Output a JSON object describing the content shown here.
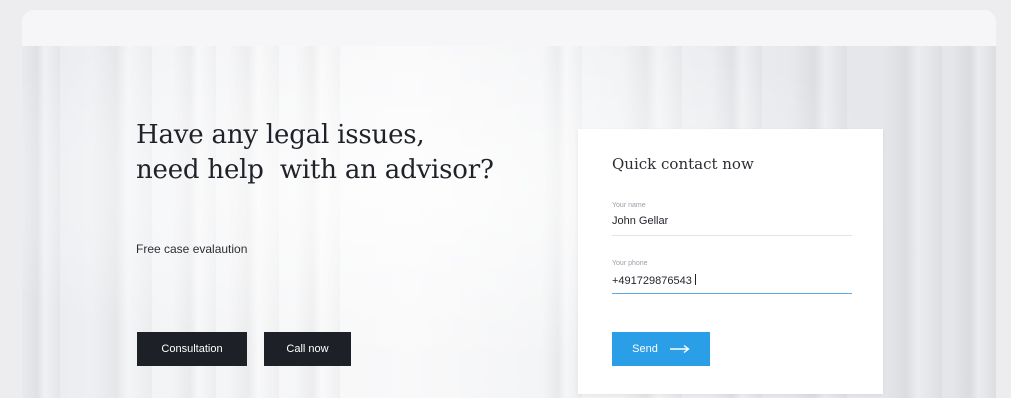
{
  "hero": {
    "headline_line1": "Have any legal issues,",
    "headline_line2": "need help  with an advisor?",
    "subtitle": "Free case evalaution",
    "consultation_label": "Consultation",
    "call_label": "Call now"
  },
  "contact_form": {
    "title": "Quick contact now",
    "name_label": "Your name",
    "name_value": "John Gellar",
    "phone_label": "Your phone",
    "phone_value": "+491729876543",
    "send_label": "Send",
    "send_icon": "arrow-right-icon"
  },
  "colors": {
    "dark_button": "#1d2026",
    "accent": "#2a9fe8"
  }
}
